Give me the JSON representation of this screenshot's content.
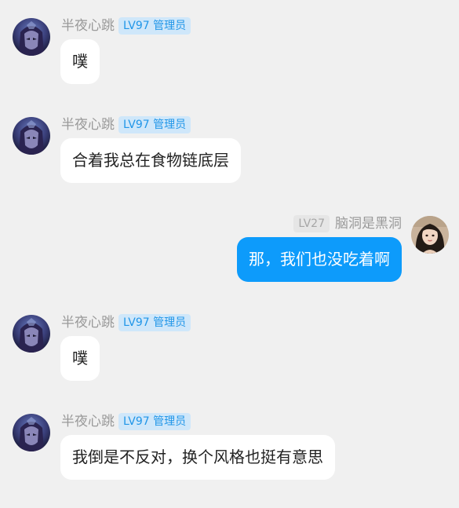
{
  "messages": [
    {
      "sender": "半夜心跳",
      "level": "LV97",
      "role": "管理员",
      "text": "噗",
      "side": "left",
      "avatar": "dark-hooded-character-avatar"
    },
    {
      "sender": "半夜心跳",
      "level": "LV97",
      "role": "管理员",
      "text": "合着我总在食物链底层",
      "side": "left",
      "avatar": "dark-hooded-character-avatar"
    },
    {
      "sender": "脑洞是黑洞",
      "level": "LV27",
      "role": "",
      "text": "那，我们也没吃着啊",
      "side": "right",
      "avatar": "girl-portrait-avatar"
    },
    {
      "sender": "半夜心跳",
      "level": "LV97",
      "role": "管理员",
      "text": "噗",
      "side": "left",
      "avatar": "dark-hooded-character-avatar"
    },
    {
      "sender": "半夜心跳",
      "level": "LV97",
      "role": "管理员",
      "text": "我倒是不反对，换个风格也挺有意思",
      "side": "left",
      "avatar": "dark-hooded-character-avatar"
    }
  ],
  "colors": {
    "background": "#f0f0f0",
    "incoming_bubble": "#ffffff",
    "outgoing_bubble": "#0d9bfb",
    "admin_badge_bg": "#cfe7fa",
    "admin_badge_text": "#2196e8",
    "level_badge_bg": "#e6e6e6",
    "nickname": "#999999"
  }
}
